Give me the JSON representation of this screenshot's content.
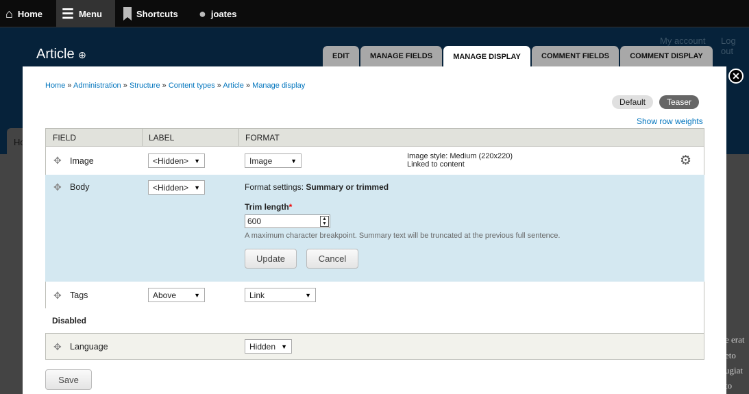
{
  "toolbar": {
    "home": "Home",
    "menu": "Menu",
    "shortcuts": "Shortcuts",
    "user": "joates"
  },
  "header": {
    "title": "Article",
    "my_account": "My account",
    "log_out": "Log out"
  },
  "tabs": [
    "EDIT",
    "MANAGE FIELDS",
    "MANAGE DISPLAY",
    "COMMENT FIELDS",
    "COMMENT DISPLAY"
  ],
  "breadcrumb": [
    "Home",
    "Administration",
    "Structure",
    "Content types",
    "Article",
    "Manage display"
  ],
  "breadcrumb_sep": "»",
  "view_modes": {
    "default": "Default",
    "teaser": "Teaser"
  },
  "show_row_weights": "Show row weights",
  "table": {
    "headers": [
      "FIELD",
      "LABEL",
      "FORMAT"
    ],
    "rows": [
      {
        "field": "Image",
        "label": "<Hidden>",
        "format": "Image",
        "summary": [
          "Image style: Medium (220x220)",
          "Linked to content"
        ]
      },
      {
        "field": "Body",
        "label": "<Hidden>",
        "settings_prefix": "Format settings: ",
        "settings_name": "Summary or trimmed",
        "trim_label": "Trim length",
        "required": "*",
        "trim_value": "600",
        "description": "A maximum character breakpoint. Summary text will be truncated at the previous full sentence.",
        "update": "Update",
        "cancel": "Cancel"
      },
      {
        "field": "Tags",
        "label": "Above",
        "format": "Link"
      }
    ],
    "disabled_heading": "Disabled",
    "disabled_rows": [
      {
        "field": "Language",
        "format": "Hidden"
      }
    ]
  },
  "save": "Save",
  "background_text": [
    "Ho",
    "e erat",
    "eto",
    "ugiat",
    "to"
  ],
  "colors": {
    "link": "#0074bd",
    "active_row": "#d4e8f1",
    "header_bg": "#06223a"
  }
}
